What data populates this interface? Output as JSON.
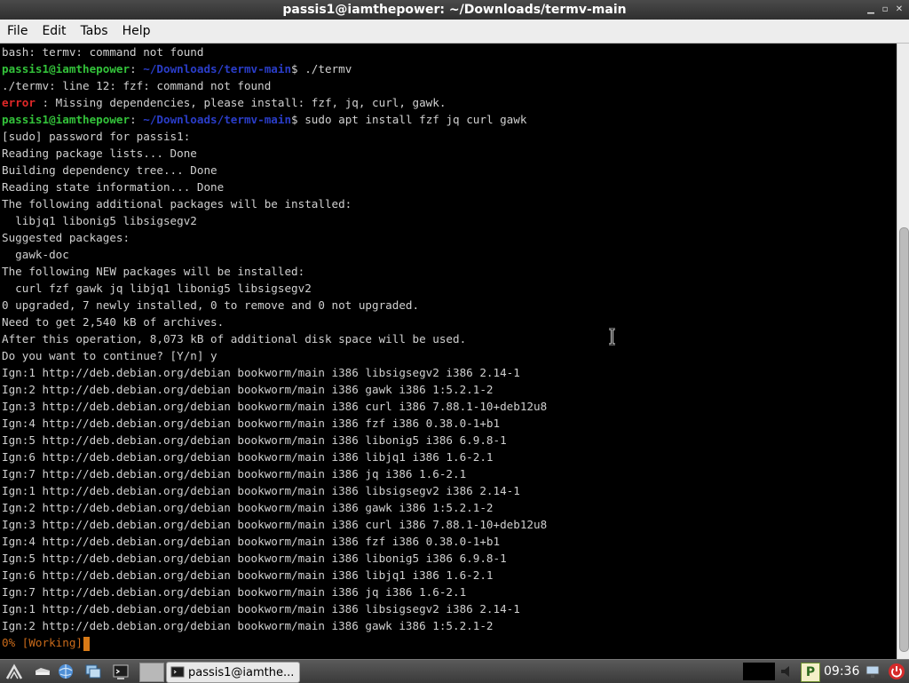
{
  "window": {
    "title": "passis1@iamthepower: ~/Downloads/termv-main"
  },
  "menu": [
    "File",
    "Edit",
    "Tabs",
    "Help"
  ],
  "prompt": {
    "user_host": "passis1@iamthepower",
    "path": "~/Downloads/termv-main",
    "symbol": "$"
  },
  "terminal": {
    "line_01": "bash: termv: command not found",
    "cmd_02": " ./termv",
    "line_03": "./termv: line 12: fzf: command not found",
    "error_label": "error",
    "error_msg": " : Missing dependencies, please install: fzf, jq, curl, gawk.",
    "cmd_05": " sudo apt install fzf jq curl gawk",
    "line_06": "[sudo] password for passis1:",
    "line_07": "Reading package lists... Done",
    "line_08": "Building dependency tree... Done",
    "line_09": "Reading state information... Done",
    "line_10": "The following additional packages will be installed:",
    "line_11": "  libjq1 libonig5 libsigsegv2",
    "line_12": "Suggested packages:",
    "line_13": "  gawk-doc",
    "line_14": "The following NEW packages will be installed:",
    "line_15": "  curl fzf gawk jq libjq1 libonig5 libsigsegv2",
    "line_16": "0 upgraded, 7 newly installed, 0 to remove and 0 not upgraded.",
    "line_17": "Need to get 2,540 kB of archives.",
    "line_18": "After this operation, 8,073 kB of additional disk space will be used.",
    "line_19": "Do you want to continue? [Y/n] y",
    "ign_lines": [
      "Ign:1 http://deb.debian.org/debian bookworm/main i386 libsigsegv2 i386 2.14-1",
      "Ign:2 http://deb.debian.org/debian bookworm/main i386 gawk i386 1:5.2.1-2",
      "Ign:3 http://deb.debian.org/debian bookworm/main i386 curl i386 7.88.1-10+deb12u8",
      "Ign:4 http://deb.debian.org/debian bookworm/main i386 fzf i386 0.38.0-1+b1",
      "Ign:5 http://deb.debian.org/debian bookworm/main i386 libonig5 i386 6.9.8-1",
      "Ign:6 http://deb.debian.org/debian bookworm/main i386 libjq1 i386 1.6-2.1",
      "Ign:7 http://deb.debian.org/debian bookworm/main i386 jq i386 1.6-2.1",
      "Ign:1 http://deb.debian.org/debian bookworm/main i386 libsigsegv2 i386 2.14-1",
      "Ign:2 http://deb.debian.org/debian bookworm/main i386 gawk i386 1:5.2.1-2",
      "Ign:3 http://deb.debian.org/debian bookworm/main i386 curl i386 7.88.1-10+deb12u8",
      "Ign:4 http://deb.debian.org/debian bookworm/main i386 fzf i386 0.38.0-1+b1",
      "Ign:5 http://deb.debian.org/debian bookworm/main i386 libonig5 i386 6.9.8-1",
      "Ign:6 http://deb.debian.org/debian bookworm/main i386 libjq1 i386 1.6-2.1",
      "Ign:7 http://deb.debian.org/debian bookworm/main i386 jq i386 1.6-2.1",
      "Ign:1 http://deb.debian.org/debian bookworm/main i386 libsigsegv2 i386 2.14-1",
      "Ign:2 http://deb.debian.org/debian bookworm/main i386 gawk i386 1:5.2.1-2"
    ],
    "progress": "0% [Working]"
  },
  "taskbar": {
    "task_label": "passis1@iamthe...",
    "clock": "09:36",
    "tray_p": "P"
  },
  "colors": {
    "terminal_bg": "#000000",
    "terminal_fg": "#d0d0d0",
    "prompt_user": "#33c23a",
    "prompt_path": "#2a3dc9",
    "error": "#e02828",
    "progress": "#c96a1a"
  }
}
